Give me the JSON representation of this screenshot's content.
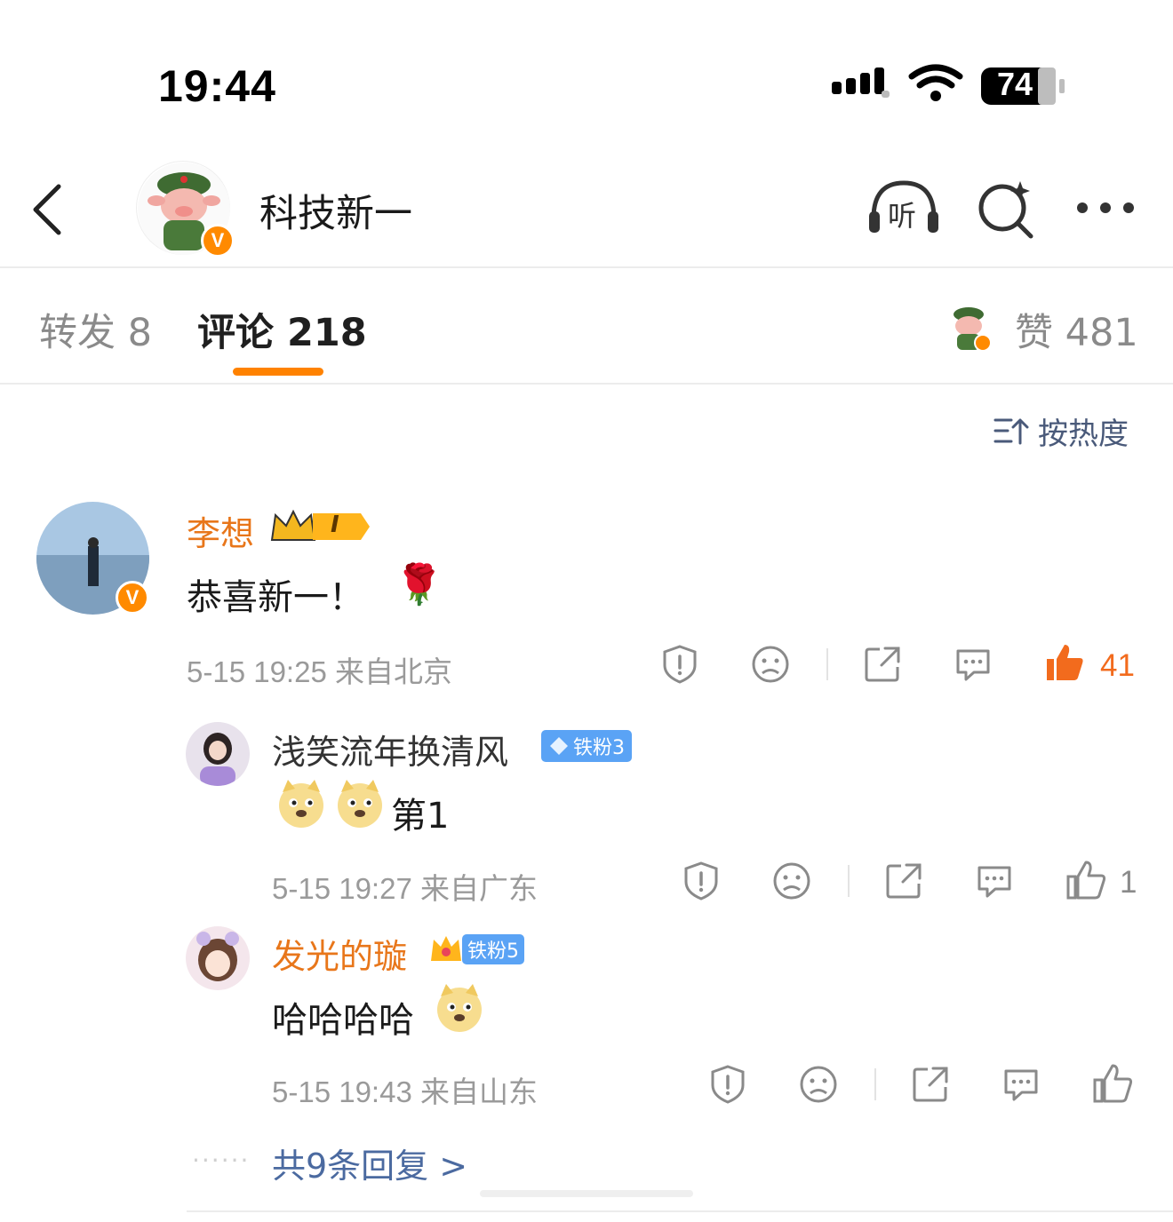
{
  "status_bar": {
    "time": "19:44",
    "battery": "74"
  },
  "header": {
    "account_name": "科技新一",
    "listen_label": "听"
  },
  "tabs": {
    "repost": "转发 8",
    "comments": "评论 218",
    "likes": "赞 481"
  },
  "sort": {
    "label": "按热度"
  },
  "comments": [
    {
      "user": "李想",
      "badge_level": "I",
      "text": "恭喜新一！",
      "emoji": "🌹",
      "meta": "5-15 19:25 来自北京",
      "likes": "41",
      "replies": [
        {
          "user": "浅笑流年换清风",
          "fan_badge": "铁粉3",
          "text": "第1",
          "meta": "5-15 19:27 来自广东",
          "likes": "1"
        },
        {
          "user": "发光的璇",
          "fan_badge": "铁粉5",
          "text": "哈哈哈哈",
          "meta": "5-15 19:43 来自山东",
          "likes": ""
        }
      ],
      "more_replies": "共9条回复 >"
    }
  ],
  "colors": {
    "accent": "#ff8200",
    "name_orange": "#e8761a",
    "link_blue": "#4b6aa0"
  }
}
